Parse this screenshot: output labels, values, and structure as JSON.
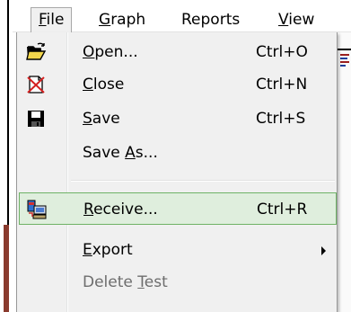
{
  "menubar": {
    "items": [
      {
        "pre": "",
        "key": "F",
        "post": "ile"
      },
      {
        "pre": "",
        "key": "G",
        "post": "raph"
      },
      {
        "pre": "",
        "key": "",
        "post": "Reports"
      },
      {
        "pre": "",
        "key": "V",
        "post": "iew"
      }
    ],
    "active_index": 0
  },
  "file_menu": {
    "items": [
      {
        "pre": "",
        "key": "O",
        "post": "pen...",
        "shortcut": "Ctrl+O",
        "icon": "open-folder-icon",
        "enabled": true
      },
      {
        "pre": "",
        "key": "C",
        "post": "lose",
        "shortcut": "Ctrl+N",
        "icon": "close-document-icon",
        "enabled": true
      },
      {
        "pre": "",
        "key": "S",
        "post": "ave",
        "shortcut": "Ctrl+S",
        "icon": "floppy-disk-icon",
        "enabled": true
      },
      {
        "pre": "Save ",
        "key": "A",
        "post": "s...",
        "shortcut": "",
        "icon": "",
        "enabled": true
      },
      {
        "pre": "",
        "key": "R",
        "post": "eceive...",
        "shortcut": "Ctrl+R",
        "icon": "receive-computer-icon",
        "enabled": true,
        "highlighted": true
      },
      {
        "pre": "",
        "key": "E",
        "post": "xport",
        "shortcut": "",
        "icon": "",
        "enabled": true,
        "submenu": true
      },
      {
        "pre": "Delete ",
        "key": "T",
        "post": "est",
        "shortcut": "",
        "icon": "",
        "enabled": false
      }
    ]
  },
  "colors": {
    "highlight_fill": "#dfeedd",
    "highlight_border": "#6fb266",
    "menu_bg": "#f0f0f0",
    "disabled_text": "#6d6d6d"
  }
}
